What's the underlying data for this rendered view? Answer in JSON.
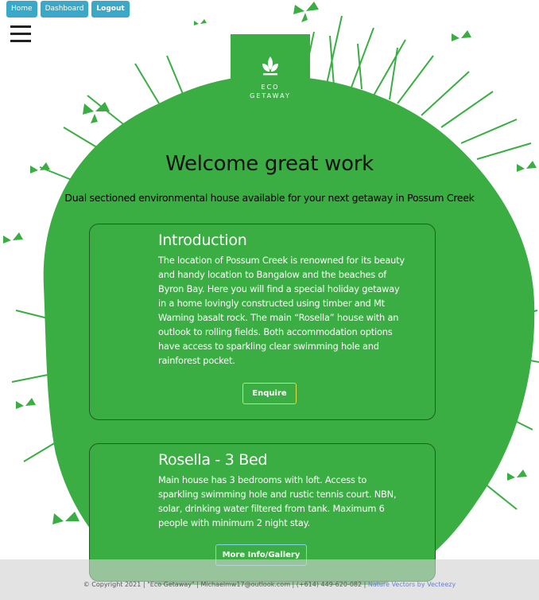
{
  "nav": {
    "home_label": "Home",
    "dashboard_label": "Dashboard",
    "logout_label": "Logout"
  },
  "logo": {
    "line1": "ECO",
    "line2": "GETAWAY",
    "icon": "leaf-icon"
  },
  "hero": {
    "title": "Welcome great work",
    "subtitle": "Dual sectioned environmental house available for your next getaway in Possum Creek"
  },
  "cards": [
    {
      "title": "Introduction",
      "body": "The location of Possum Creek is renowned for its beauty and handy location to Bangalow and the beaches of Byron Bay. Here you will find a special holiday getaway in a home lovingly constructed using timber and Mt Warning basalt rock. The main “Rosella” house with an outlook to rolling fields. Both accommodation options have access to sparkling clear swimming hole and rainforest pocket.",
      "button": "Enquire"
    },
    {
      "title": "Rosella - 3 Bed",
      "body": "Main house has 3 bedrooms with loft. Access to sparkling swimming hole and rustic tennis court. NBN, solar, drinking water filtered from tank. Maximum 6 people with minimum 2 night stay.",
      "button": "More Info/Gallery"
    }
  ],
  "footer": {
    "text": "© Copyright 2021 | \"Eco Getaway\" | Michaelmw17@outlook.com | (+614) 449-620-082 |",
    "link": "Nature Vectors by Vecteezy"
  },
  "colors": {
    "brand_green": "#3aae42",
    "nav_blue": "#3aa9c9"
  }
}
